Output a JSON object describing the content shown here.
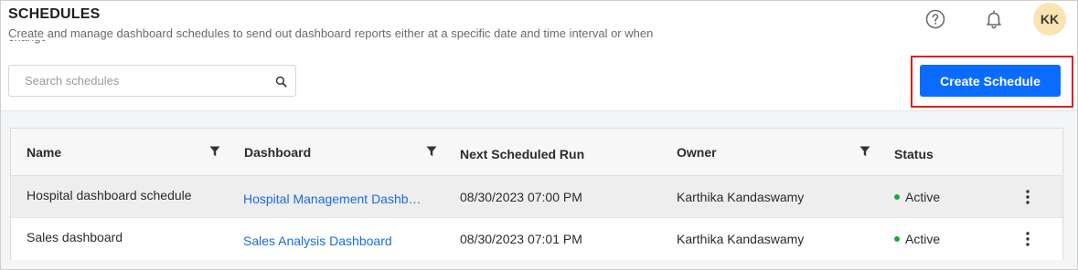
{
  "header": {
    "title": "SCHEDULES",
    "subtitle": "Create and manage dashboard schedules to send out dashboard reports either at a specific date and time interval or when",
    "subtitle_overflow": "changes",
    "help_icon": "help-circle-icon",
    "bell_icon": "bell-icon",
    "avatar_initials": "KK"
  },
  "toolbar": {
    "search_placeholder": "Search schedules",
    "search_value": "",
    "create_label": "Create Schedule"
  },
  "colors": {
    "accent": "#0a6cff",
    "link": "#1a6ce0",
    "active": "#1ba93a",
    "highlight": "#e01e1e",
    "avatar_bg": "#fbe3b2"
  },
  "table": {
    "columns": {
      "name": "Name",
      "dashboard": "Dashboard",
      "next_run": "Next Scheduled Run",
      "owner": "Owner",
      "status": "Status"
    },
    "rows": [
      {
        "name": "Hospital dashboard schedule",
        "dashboard": "Hospital Management Dashb…",
        "next_run": "08/30/2023 07:00 PM",
        "owner": "Karthika Kandaswamy",
        "status": "Active"
      },
      {
        "name": "Sales dashboard",
        "dashboard": "Sales Analysis Dashboard",
        "next_run": "08/30/2023 07:01 PM",
        "owner": "Karthika Kandaswamy",
        "status": "Active"
      }
    ]
  }
}
